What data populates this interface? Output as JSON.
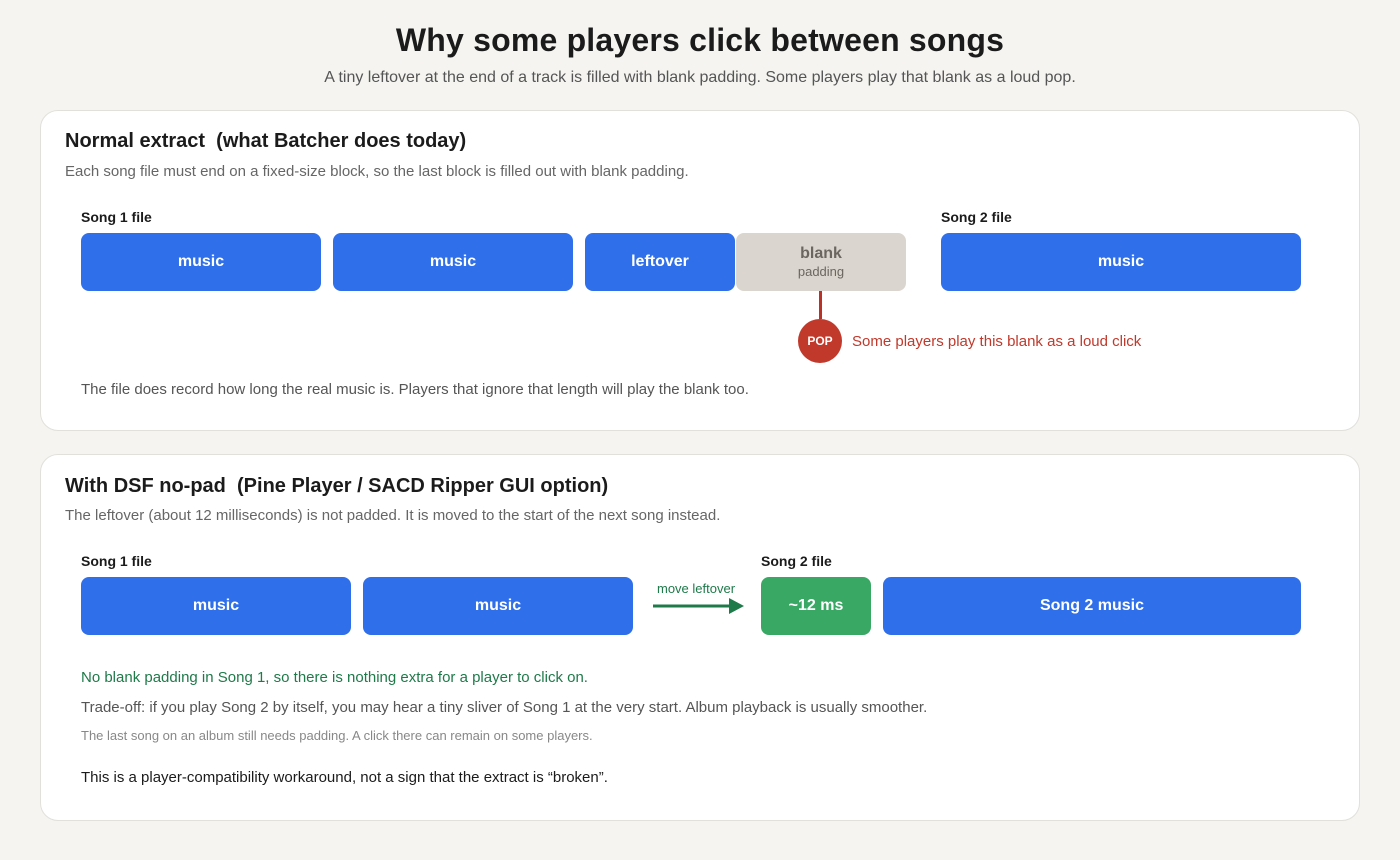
{
  "title": "Why some players click between songs",
  "subtitle": "A tiny leftover at the end of a track is filled with blank padding. Some players play that blank as a loud pop.",
  "colors": {
    "music": "#2f6fe9",
    "padding": "#dad5ce",
    "pop": "#c0392b",
    "moved": "#3aa865",
    "positive_text": "#1f7a4a"
  },
  "panel_normal": {
    "title": "Normal extract  (what Batcher does today)",
    "description": "Each song file must end on a fixed-size block, so the last block is filled out with blank padding.",
    "song1_label": "Song 1 file",
    "song2_label": "Song 2 file",
    "song1_blocks": [
      "music",
      "music",
      "leftover"
    ],
    "padding_block": {
      "label": "blank",
      "sublabel": "padding"
    },
    "song2_block": "music",
    "pop_badge": "POP",
    "pop_note": "Some players play this blank as a loud click",
    "footnote": "The file does record how long the real music is. Players that ignore that length will play the blank too."
  },
  "panel_nopad": {
    "title": "With DSF no-pad  (Pine Player / SACD Ripper GUI option)",
    "description": "The leftover (about 12 milliseconds) is not padded. It is moved to the start of the next song instead.",
    "song1_label": "Song 1 file",
    "song2_label": "Song 2 file",
    "song1_blocks": [
      "music",
      "music"
    ],
    "arrow_label": "move leftover",
    "moved_block": "~12 ms",
    "song2_block": "Song 2 music",
    "note_positive": "No blank padding in Song 1, so there is nothing extra for a player to click on.",
    "note_tradeoff": "Trade-off: if you play Song 2 by itself, you may hear a tiny sliver of Song 1 at the very start. Album playback is usually smoother.",
    "note_last_song": "The last song on an album still needs padding. A click there can remain on some players.",
    "note_summary": "This is a player-compatibility workaround, not a sign that the extract is “broken”."
  }
}
